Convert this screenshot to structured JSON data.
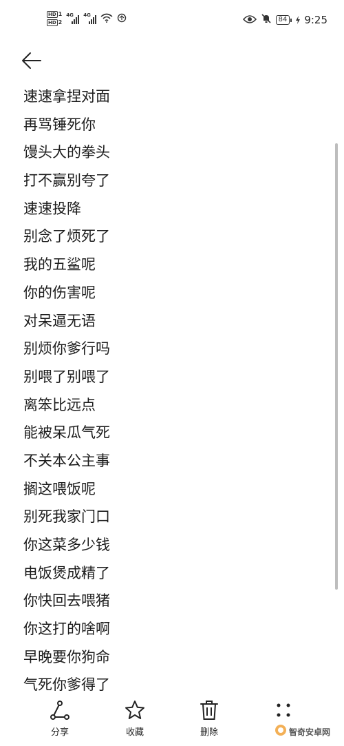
{
  "status_bar": {
    "sim1_label": "HD",
    "sim1_num": "1",
    "sim2_label": "HD",
    "sim2_num": "2",
    "network1": "4G",
    "network2": "4G",
    "battery": "84",
    "time": "9:25"
  },
  "phrases": [
    "速速拿捏对面",
    "再骂锤死你",
    "馒头大的拳头",
    "打不赢别夸了",
    "速速投降",
    "别念了烦死了",
    "我的五鲨呢",
    "你的伤害呢",
    "对呆逼无语",
    "别烦你爹行吗",
    "别喂了别喂了",
    "离笨比远点",
    "能被呆瓜气死",
    "不关本公主事",
    "搁这喂饭呢",
    "别死我家门口",
    "你这菜多少钱",
    "电饭煲成精了",
    "你快回去喂猪",
    "你这打的啥啊",
    "早晚要你狗命",
    "气死你爹得了"
  ],
  "toolbar": {
    "share_label": "分享",
    "favorite_label": "收藏",
    "delete_label": "删除"
  },
  "watermark": {
    "text": "智奇安卓网"
  },
  "icons": {
    "back": "arrow-left-icon",
    "share": "share-icon",
    "favorite": "star-icon",
    "delete": "trash-icon",
    "more": "more-dots-icon"
  }
}
